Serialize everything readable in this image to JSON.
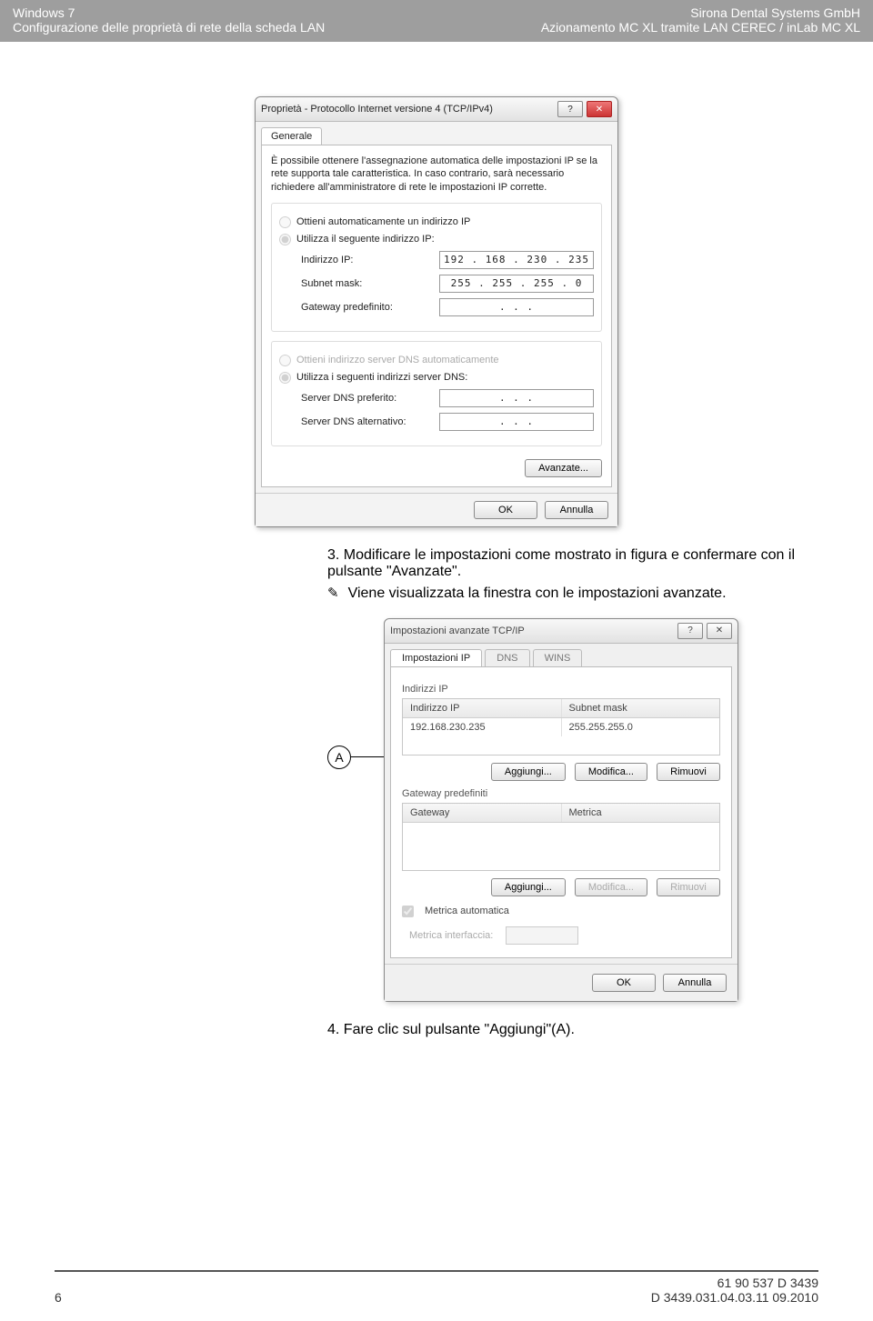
{
  "header": {
    "left1": "Windows 7",
    "right1": "Sirona Dental Systems GmbH",
    "left2": "Configurazione delle proprietà di rete della scheda LAN",
    "right2": "Azionamento MC XL tramite LAN CEREC / inLab MC XL"
  },
  "dlg1": {
    "title": "Proprietà - Protocollo Internet versione 4 (TCP/IPv4)",
    "help": "?",
    "close": "✕",
    "tab": "Generale",
    "intro": "È possibile ottenere l'assegnazione automatica delle impostazioni IP se la rete supporta tale caratteristica. In caso contrario, sarà necessario richiedere all'amministratore di rete le impostazioni IP corrette.",
    "r_auto_ip": "Ottieni automaticamente un indirizzo IP",
    "r_static_ip": "Utilizza il seguente indirizzo IP:",
    "f_ip_label": "Indirizzo IP:",
    "f_ip_val": "192 . 168 . 230 . 235",
    "f_mask_label": "Subnet mask:",
    "f_mask_val": "255 . 255 . 255 .   0",
    "f_gw_label": "Gateway predefinito:",
    "f_gw_val": ".       .       .",
    "r_auto_dns": "Ottieni indirizzo server DNS automaticamente",
    "r_static_dns": "Utilizza i seguenti indirizzi server DNS:",
    "f_dns1_label": "Server DNS preferito:",
    "f_dns1_val": ".       .       .",
    "f_dns2_label": "Server DNS alternativo:",
    "f_dns2_val": ".       .       .",
    "advanced": "Avanzate...",
    "ok": "OK",
    "cancel": "Annulla"
  },
  "step3": {
    "num": "3.",
    "text": "Modificare le impostazioni come mostrato in figura e confermare con il pulsante \"Avanzate\".",
    "result": "Viene visualizzata la finestra con le impostazioni avanzate."
  },
  "callout": {
    "letter": "A"
  },
  "dlg2": {
    "title": "Impostazioni avanzate TCP/IP",
    "help": "?",
    "close": "✕",
    "tab1": "Impostazioni IP",
    "tab2": "DNS",
    "tab3": "WINS",
    "grp_ip": "Indirizzi IP",
    "col_ip": "Indirizzo IP",
    "col_mask": "Subnet mask",
    "row_ip": "192.168.230.235",
    "row_mask": "255.255.255.0",
    "grp_gw": "Gateway predefiniti",
    "col_gw": "Gateway",
    "col_metric": "Metrica",
    "btn_add": "Aggiungi...",
    "btn_edit": "Modifica...",
    "btn_remove": "Rimuovi",
    "chk_auto_metric": "Metrica automatica",
    "lbl_if_metric": "Metrica interfaccia:",
    "ok": "OK",
    "cancel": "Annulla"
  },
  "step4": {
    "num": "4.",
    "text": "Fare clic sul pulsante \"Aggiungi\"(A)."
  },
  "footer": {
    "page": "6",
    "code1": "61 90 537 D 3439",
    "code2": "D 3439.031.04.03.11   09.2010"
  }
}
